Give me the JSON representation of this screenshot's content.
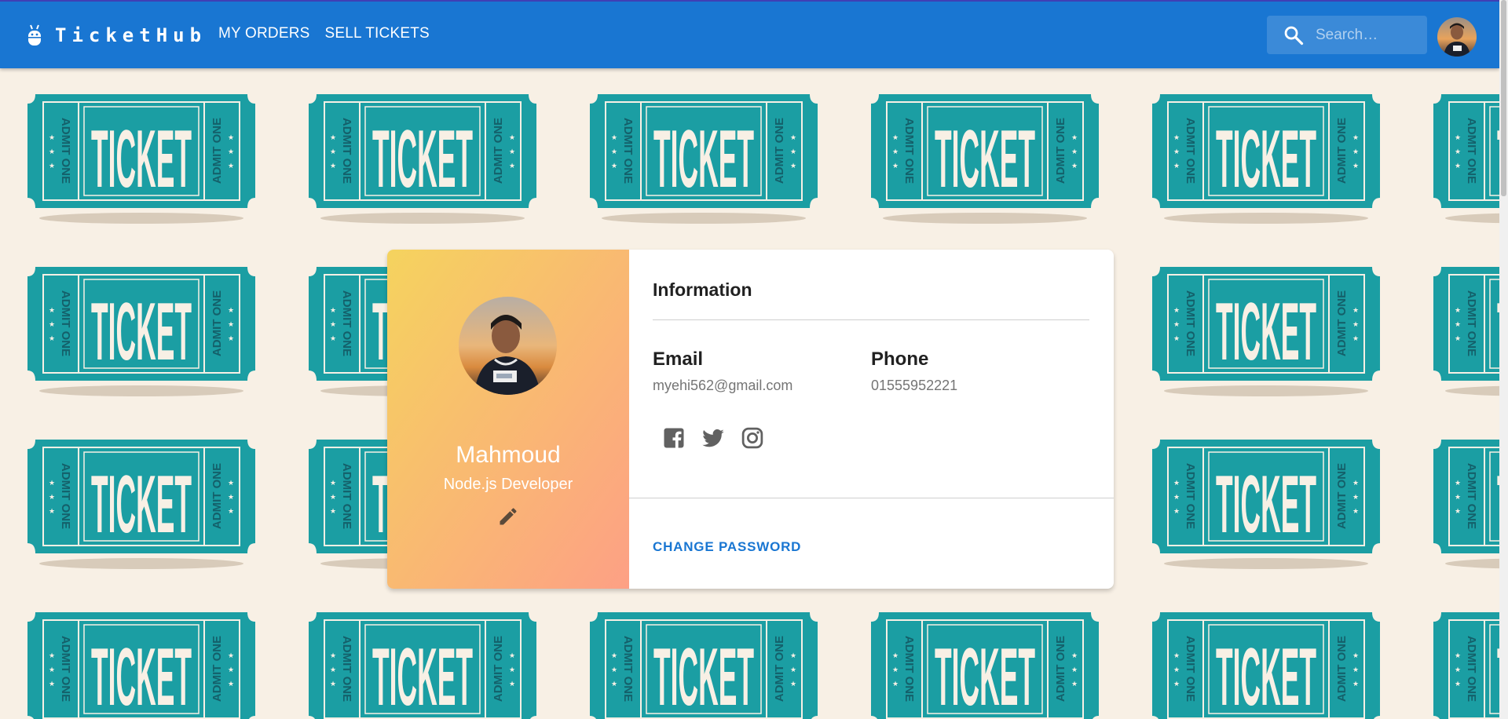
{
  "app": {
    "brand": "TicketHub",
    "nav": [
      "MY ORDERS",
      "SELL TICKETS"
    ],
    "search_placeholder": "Search…"
  },
  "background": {
    "ticket_word": "TICKET",
    "side_text": "ADMIT ONE",
    "ticket_color": "#1b9ea3",
    "background_color": "#f8f0e5"
  },
  "profile": {
    "name": "Mahmoud",
    "role": "Node.js Developer"
  },
  "info": {
    "title": "Information",
    "email_label": "Email",
    "email": "myehi562@gmail.com",
    "phone_label": "Phone",
    "phone": "01555952221",
    "social": [
      "facebook-icon",
      "twitter-icon",
      "instagram-icon"
    ],
    "change_password": "CHANGE PASSWORD"
  },
  "colors": {
    "appbar": "#1976d2",
    "gradient_start": "#f5d35e",
    "gradient_end": "#fda085",
    "link": "#1976d2"
  }
}
